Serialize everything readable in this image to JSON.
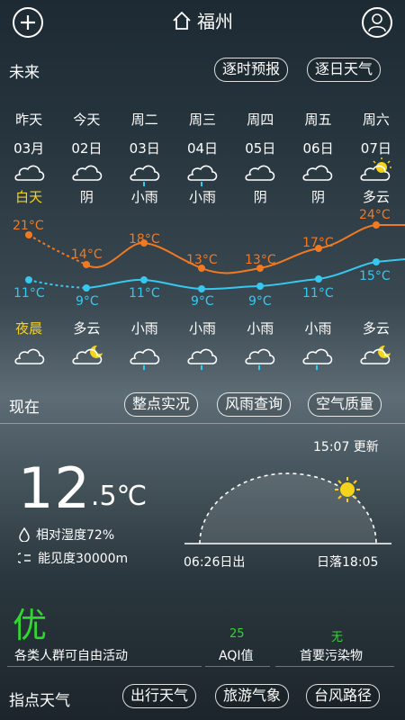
{
  "header": {
    "city": "福州"
  },
  "future": {
    "label": "未来",
    "hourly_btn": "逐时预报",
    "daily_btn": "逐日天气"
  },
  "days": [
    {
      "week": "昨天",
      "date": "03月",
      "day_weather": "白天",
      "night_weather": "夜晨"
    },
    {
      "week": "今天",
      "date": "02日",
      "day_weather": "阴",
      "night_weather": "多云"
    },
    {
      "week": "周二",
      "date": "03日",
      "day_weather": "小雨",
      "night_weather": "小雨"
    },
    {
      "week": "周三",
      "date": "04日",
      "day_weather": "小雨",
      "night_weather": "小雨"
    },
    {
      "week": "周四",
      "date": "05日",
      "day_weather": "阴",
      "night_weather": "小雨"
    },
    {
      "week": "周五",
      "date": "06日",
      "day_weather": "阴",
      "night_weather": "小雨"
    },
    {
      "week": "周六",
      "date": "07日",
      "day_weather": "多云",
      "night_weather": "多云"
    }
  ],
  "high_temps": [
    "21°C",
    "14°C",
    "18°C",
    "13°C",
    "13°C",
    "17°C",
    "24°C"
  ],
  "low_temps": [
    "11°C",
    "9°C",
    "11°C",
    "9°C",
    "9°C",
    "11°C",
    "15°C"
  ],
  "now": {
    "label": "现在",
    "btn_hourly": "整点实况",
    "btn_rain": "风雨查询",
    "btn_air": "空气质量",
    "updated": "15:07 更新",
    "temp_int": "12",
    "temp_dec": ".5",
    "temp_unit": "℃",
    "humidity": "相对湿度72%",
    "visibility": "能见度30000m",
    "sunrise": "06:26日出",
    "sunset": "日落18:05"
  },
  "air": {
    "grade": "优",
    "advice": "各类人群可自由活动",
    "aqi_value": "25",
    "aqi_label": "AQI值",
    "pollutant_value": "无",
    "pollutant_label": "首要污染物"
  },
  "footer": {
    "label": "指点天气",
    "btn_travel": "出行天气",
    "btn_tour": "旅游气象",
    "btn_typhoon": "台风路径"
  },
  "colors": {
    "high": "#f2791f",
    "low": "#37c8f0",
    "day_label": "#f5d31b",
    "grade": "#2ed82e"
  },
  "icons": {
    "add": "plus-icon",
    "home": "home-icon",
    "user": "user-icon"
  }
}
